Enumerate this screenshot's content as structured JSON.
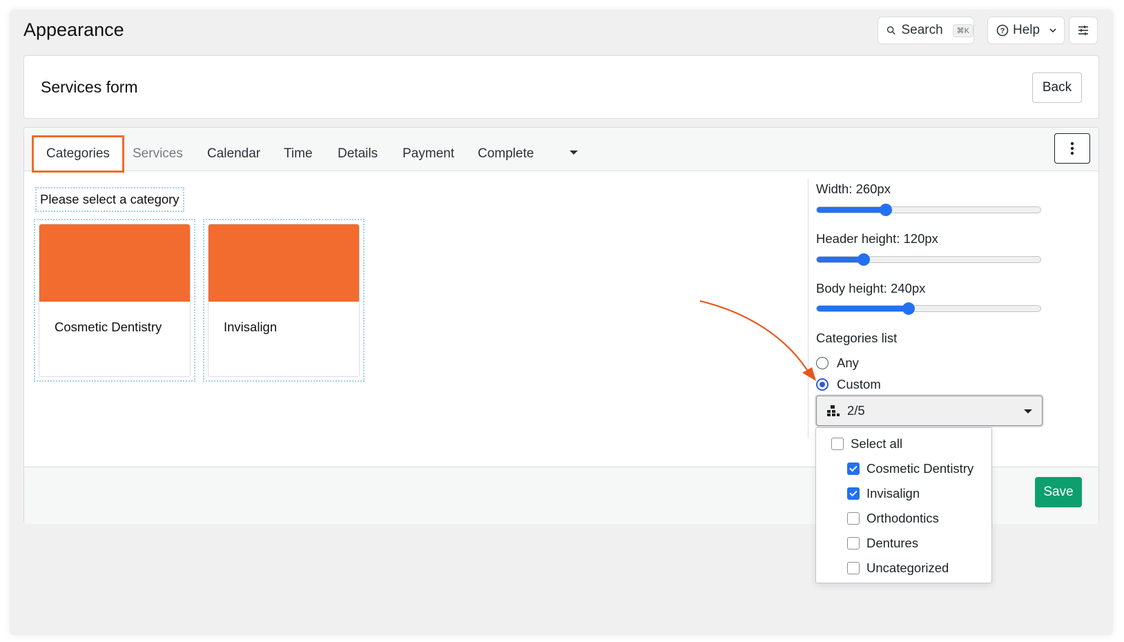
{
  "page": {
    "title": "Appearance"
  },
  "topbar": {
    "search_label": "Search",
    "search_shortcut": "⌘K",
    "help_label": "Help"
  },
  "form": {
    "title": "Services form",
    "back_label": "Back",
    "save_label": "Save"
  },
  "tabs": [
    {
      "label": "Categories",
      "state": "active"
    },
    {
      "label": "Services",
      "state": "muted"
    },
    {
      "label": "Calendar",
      "state": "normal"
    },
    {
      "label": "Time",
      "state": "normal"
    },
    {
      "label": "Details",
      "state": "normal"
    },
    {
      "label": "Payment",
      "state": "normal"
    },
    {
      "label": "Complete",
      "state": "normal"
    }
  ],
  "preview": {
    "prompt": "Please select a category",
    "cards": [
      {
        "name": "Cosmetic Dentistry"
      },
      {
        "name": "Invisalign"
      }
    ],
    "card_header_color": "#f26b2f"
  },
  "settings": {
    "width": {
      "label": "Width: 260px",
      "level": 0.31
    },
    "header_height": {
      "label": "Header height: 120px",
      "level": 0.21
    },
    "body_height": {
      "label": "Body height: 240px",
      "level": 0.41
    },
    "categories_list": {
      "label": "Categories list",
      "options": [
        {
          "label": "Any",
          "checked": false
        },
        {
          "label": "Custom",
          "checked": true
        }
      ],
      "select_value": "2/5",
      "dropdown": {
        "select_all": {
          "label": "Select all",
          "checked": false
        },
        "items": [
          {
            "label": "Cosmetic Dentistry",
            "checked": true
          },
          {
            "label": "Invisalign",
            "checked": true
          },
          {
            "label": "Orthodontics",
            "checked": false
          },
          {
            "label": "Dentures",
            "checked": false
          },
          {
            "label": "Uncategorized",
            "checked": false
          }
        ]
      }
    }
  },
  "colors": {
    "accent": "#f26b2b",
    "slider": "#2271f1",
    "save": "#0e9f6e"
  }
}
